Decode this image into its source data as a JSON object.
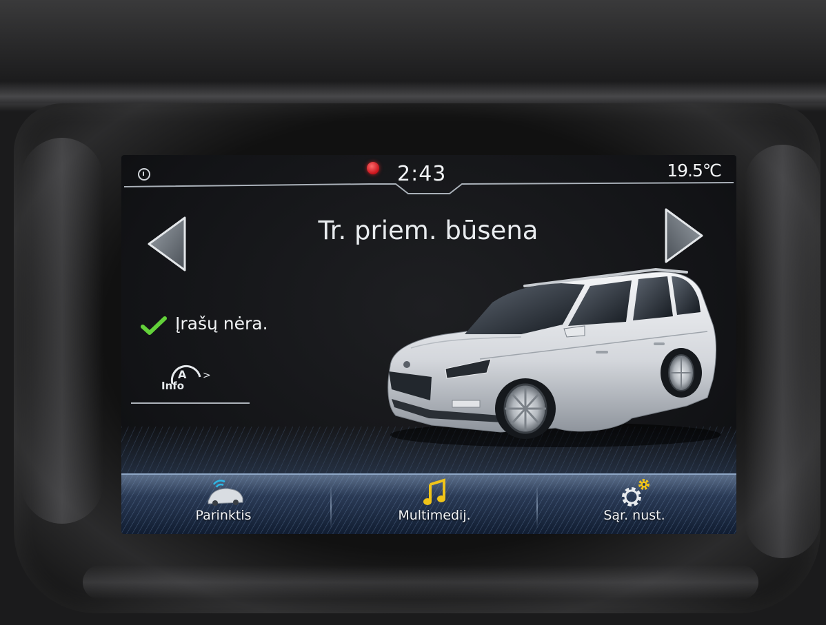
{
  "status_bar": {
    "time": "2:43",
    "temperature": "19.5℃"
  },
  "page": {
    "title": "Tr. priem. būsena"
  },
  "vehicle_status": {
    "message": "Įrašų nėra.",
    "info_button_label": "Info"
  },
  "bottom_menu": {
    "items": [
      {
        "label": "Parinktis",
        "icon": "car-wifi-icon"
      },
      {
        "label": "Multimedij.",
        "icon": "music-note-icon"
      },
      {
        "label": "Sąr. nust.",
        "icon": "settings-gear-icon"
      }
    ]
  },
  "colors": {
    "check": "#63d13a",
    "music_icon": "#f0c419",
    "record_indicator": "#e0181f",
    "menu_bar": "#2a3a55"
  }
}
